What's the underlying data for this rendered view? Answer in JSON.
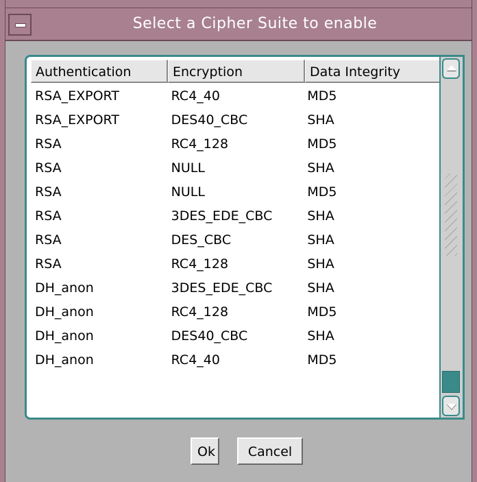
{
  "window": {
    "title": "Select a Cipher Suite to enable",
    "frame_color": "#a8808f",
    "accent_color": "#3a8a8a"
  },
  "table": {
    "columns": [
      "Authentication",
      "Encryption",
      "Data Integrity"
    ],
    "rows": [
      [
        "RSA_EXPORT",
        "RC4_40",
        "MD5"
      ],
      [
        "RSA_EXPORT",
        "DES40_CBC",
        "SHA"
      ],
      [
        "RSA",
        "RC4_128",
        "MD5"
      ],
      [
        "RSA",
        "NULL",
        "SHA"
      ],
      [
        "RSA",
        "NULL",
        "MD5"
      ],
      [
        "RSA",
        "3DES_EDE_CBC",
        "SHA"
      ],
      [
        "RSA",
        "DES_CBC",
        "SHA"
      ],
      [
        "RSA",
        "RC4_128",
        "SHA"
      ],
      [
        "DH_anon",
        "3DES_EDE_CBC",
        "SHA"
      ],
      [
        "DH_anon",
        "RC4_128",
        "MD5"
      ],
      [
        "DH_anon",
        "DES40_CBC",
        "SHA"
      ],
      [
        "DH_anon",
        "RC4_40",
        "MD5"
      ]
    ]
  },
  "buttons": {
    "ok_label": "Ok",
    "cancel_label": "Cancel"
  },
  "icons": {
    "window_menu": "window-menu-icon",
    "scroll_up": "arrow-up-icon",
    "scroll_down": "arrow-down-icon"
  }
}
